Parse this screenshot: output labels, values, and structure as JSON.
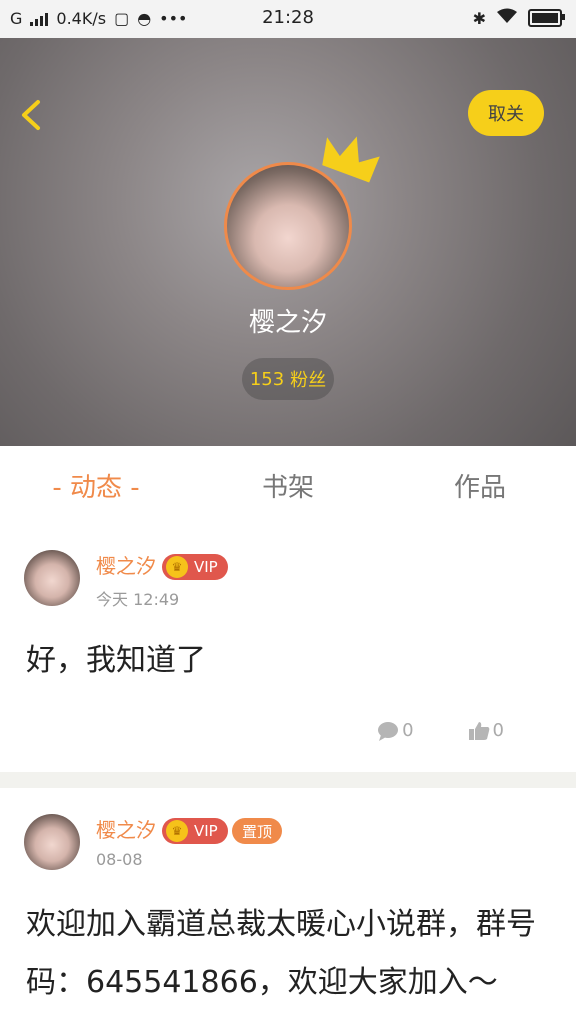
{
  "statusbar": {
    "carrier": "G",
    "speed": "0.4K/s",
    "time": "21:28",
    "more": "•••"
  },
  "profile": {
    "follow_label": "取关",
    "name": "樱之汐",
    "fans_count": "153",
    "fans_label": "粉丝"
  },
  "tabs": [
    {
      "label": "- 动态 -",
      "active": true
    },
    {
      "label": "书架",
      "active": false
    },
    {
      "label": "作品",
      "active": false
    }
  ],
  "posts": [
    {
      "author": "樱之汐",
      "vip_label": "VIP",
      "time": "今天 12:49",
      "text": "好，我知道了",
      "comments": "0",
      "likes": "0"
    },
    {
      "author": "樱之汐",
      "vip_label": "VIP",
      "pinned_label": "置顶",
      "time": "08-08",
      "text": "欢迎加入霸道总裁太暖心小说群，群号码：645541866，欢迎大家加入～"
    }
  ],
  "colors": {
    "accent": "#f08a4a",
    "follow_bg": "#f6cf1a",
    "vip_bg": "#e0574c"
  }
}
